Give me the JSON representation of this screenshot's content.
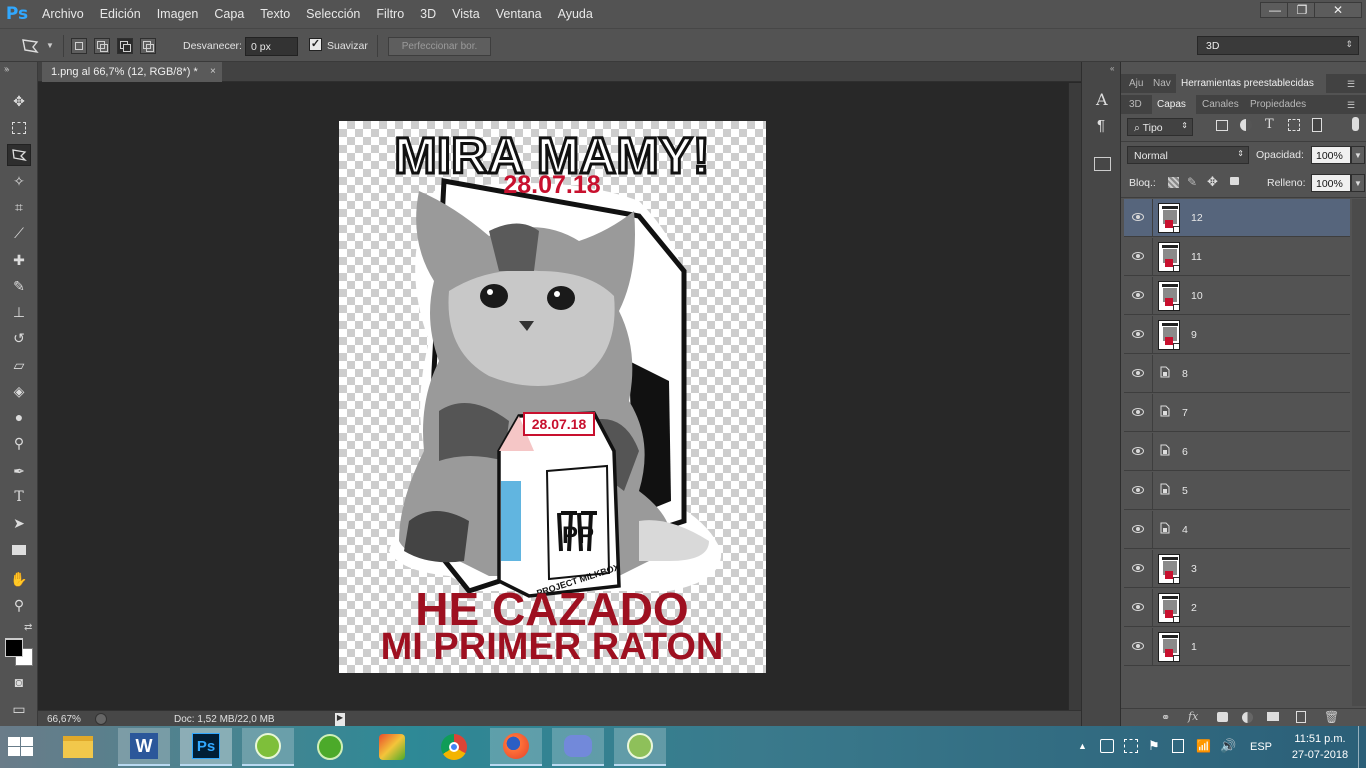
{
  "app": {
    "logo": "Ps",
    "menu": [
      "Archivo",
      "Edición",
      "Imagen",
      "Capa",
      "Texto",
      "Selección",
      "Filtro",
      "3D",
      "Vista",
      "Ventana",
      "Ayuda"
    ]
  },
  "window_controls": {
    "minimize": "—",
    "restore": "❐",
    "close": "✕"
  },
  "options_bar": {
    "feather_label": "Desvanecer:",
    "feather_value": "0 px",
    "smooth_label": "Suavizar",
    "smooth_checked": true,
    "refine_label": "Perfeccionar bor.",
    "workspace": "3D"
  },
  "document": {
    "tab_label": "1.png al 66,7% (12, RGB/8*) *",
    "close_glyph": "×",
    "zoom": "66,67%",
    "doc_size": "Doc: 1,52 MB/22,0 MB"
  },
  "artwork": {
    "headline": "MIRA MAMY!",
    "date": "28.07.18",
    "box_date": "28.07.18",
    "box_brand": "PROJECT MILKBOX",
    "box_logo": "PP",
    "bottom_line1": "HE CAZADO",
    "bottom_line2": "MI PRIMER RATON"
  },
  "right_panel": {
    "top_tabs": [
      "Aju",
      "Nav",
      "Herramientas preestablecidas"
    ],
    "tabs": [
      "3D",
      "Capas",
      "Canales",
      "Propiedades"
    ],
    "active_tab": "Capas",
    "filter_label": "Tipo",
    "blend_mode": "Normal",
    "opacity_label": "Opacidad:",
    "opacity_value": "100%",
    "lock_label": "Bloq.:",
    "fill_label": "Relleno:",
    "fill_value": "100%",
    "layers": [
      {
        "name": "12",
        "thumb": "art",
        "selected": true
      },
      {
        "name": "11",
        "thumb": "art",
        "selected": false
      },
      {
        "name": "10",
        "thumb": "art",
        "selected": false
      },
      {
        "name": "9",
        "thumb": "art",
        "selected": false
      },
      {
        "name": "8",
        "thumb": "empty",
        "selected": false
      },
      {
        "name": "7",
        "thumb": "empty",
        "selected": false
      },
      {
        "name": "6",
        "thumb": "empty",
        "selected": false
      },
      {
        "name": "5",
        "thumb": "empty",
        "selected": false
      },
      {
        "name": "4",
        "thumb": "empty",
        "selected": false
      },
      {
        "name": "3",
        "thumb": "art",
        "selected": false
      },
      {
        "name": "2",
        "thumb": "art",
        "selected": false
      },
      {
        "name": "1",
        "thumb": "art",
        "selected": false
      }
    ]
  },
  "taskbar": {
    "apps": [
      "file-explorer",
      "word",
      "photoshop",
      "corel-app-1",
      "corel-app-2",
      "image-app",
      "chrome",
      "firefox",
      "discord",
      "corel-app-3"
    ],
    "tray_lang": "ESP",
    "time": "11:51 p.m.",
    "date": "27-07-2018"
  },
  "colors": {
    "ui_dark": "#535353",
    "selection": "#56657c",
    "accent_red": "#c8102e",
    "ps_blue": "#31a8ff"
  }
}
